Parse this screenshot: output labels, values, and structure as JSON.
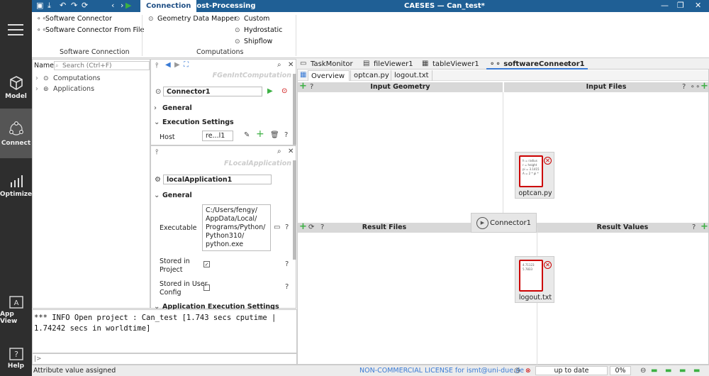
{
  "nav": [
    {
      "label": "Model",
      "icon": "cube-icon"
    },
    {
      "label": "Connect",
      "icon": "connect-icon"
    },
    {
      "label": "Optimize",
      "icon": "chart-icon"
    },
    {
      "label": "App View",
      "icon": "appview-icon"
    },
    {
      "label": "Help",
      "icon": "help-icon"
    }
  ],
  "title": "CAESES — Can_test*",
  "ribbon_tabs": [
    "Connection",
    "Post-Processing"
  ],
  "ribbon": {
    "software_connector": "Software Connector",
    "software_connector_from_file": "Software Connector From File",
    "group1": "Software Connection",
    "geometry_data_mapper": "Geometry Data Mapper",
    "custom": "Custom",
    "hydrostatic": "Hydrostatic",
    "shipflow": "Shipflow",
    "group2": "Computations"
  },
  "tree": {
    "name_label": "Name",
    "search_placeholder": "Search (Ctrl+F)",
    "items": [
      "Computations",
      "Applications"
    ]
  },
  "props1": {
    "faded_title": "FGenIntComputation",
    "name_value": "Connector1",
    "general": "General",
    "exec_settings": "Execution Settings",
    "host_label": "Host",
    "host_value": "re...l1"
  },
  "props2": {
    "faded_title": "FLocalApplication",
    "name_value": "localApplication1",
    "general": "General",
    "executable_label": "Executable",
    "executable_lines": [
      "C:/Users/fengy/",
      "AppData/Local/",
      "Programs/Python/",
      "Python310/",
      "python.exe"
    ],
    "stored_project": [
      "Stored in",
      "Project"
    ],
    "stored_user": [
      "Stored in User",
      "Config"
    ],
    "app_exec": "Application Execution Settings"
  },
  "doc_tabs": [
    "TaskMonitor",
    "fileViewer1",
    "tableViewer1",
    "softwareConnector1"
  ],
  "sub_tabs": [
    "Overview",
    "optcan.py",
    "logout.txt"
  ],
  "canvas": {
    "input_geometry": "Input Geometry",
    "input_files": "Input Files",
    "result_files": "Result Files",
    "result_values": "Result Values",
    "connector": "Connector1",
    "file1": {
      "name": "optcan.py",
      "preview": [
        "h = radius",
        "r = height",
        "pi = 3.1415",
        "A = 2 * pi *"
      ]
    },
    "file2": {
      "name": "logout.txt",
      "preview": [
        "4.71123",
        "5.7833"
      ]
    }
  },
  "console_lines": [
    "*** INFO Open project : Can_test [1.743 secs cputime |",
    "1.74242 secs in worldtime]"
  ],
  "console_prompt": "|>",
  "status": {
    "left": "Attribute value assigned",
    "license": "NON-COMMERCIAL LICENSE for ismt@uni-due.de",
    "update": "up to date",
    "percent": "0%"
  },
  "colors": {
    "accent": "#1f5f95",
    "green": "#3cb043",
    "red": "#cc0000"
  }
}
